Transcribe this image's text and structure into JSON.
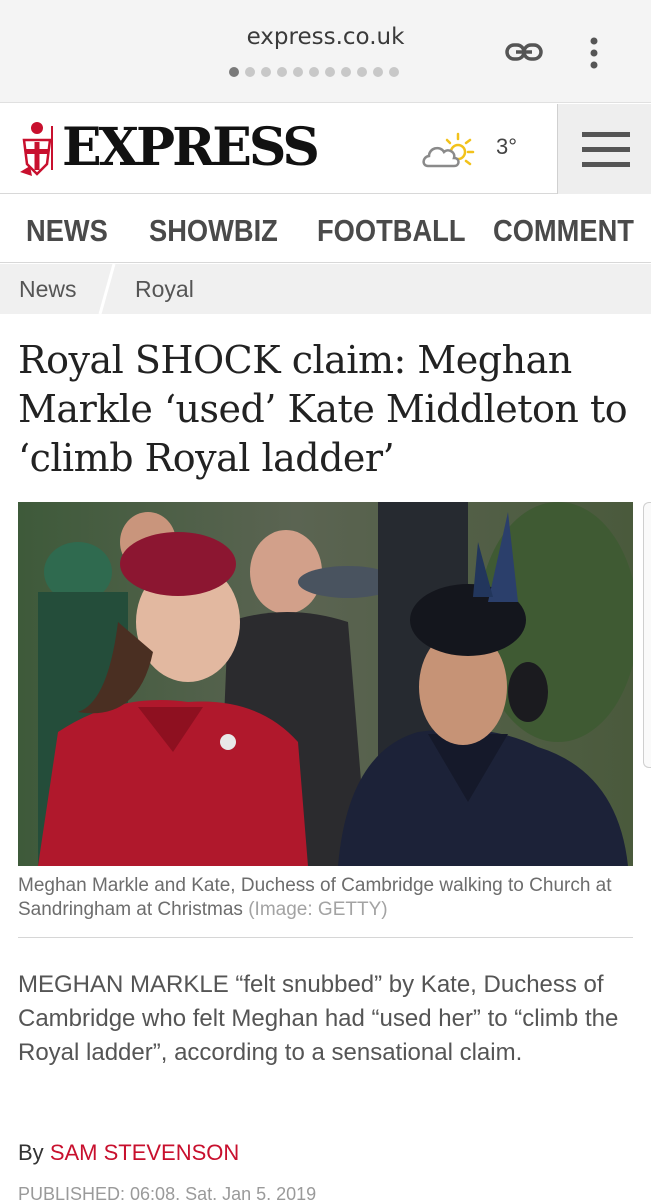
{
  "browser": {
    "url": "express.co.uk",
    "tab_count": 11,
    "active_tab_index": 0
  },
  "site": {
    "logo": "EXPRESS",
    "weather_temp": "3°",
    "weather_icon": "partly-cloudy-icon"
  },
  "nav": {
    "items": [
      "NEWS",
      "SHOWBIZ",
      "FOOTBALL",
      "COMMENT"
    ]
  },
  "breadcrumb": {
    "items": [
      "News",
      "Royal"
    ]
  },
  "article": {
    "headline": "Royal SHOCK claim: Meghan Markle ‘used’ Kate Middleton to ‘climb Royal ladder’",
    "caption": "Meghan Markle and Kate, Duchess of Cambridge walking to Church at Sandringham at Christmas",
    "image_credit": "(Image: GETTY)",
    "standfirst": "MEGHAN MARKLE “felt snubbed” by Kate, Duchess of Cambridge who felt Meghan had “used her” to “climb the Royal ladder”, according to a sensational claim.",
    "byline_prefix": "By",
    "author": "SAM STEVENSON",
    "published": "PUBLISHED: 06:08, Sat, Jan 5, 2019"
  },
  "colors": {
    "accent_red": "#c8102e",
    "nav_text": "#4a4a4a",
    "breadcrumb_bg": "#f0f0f0"
  }
}
